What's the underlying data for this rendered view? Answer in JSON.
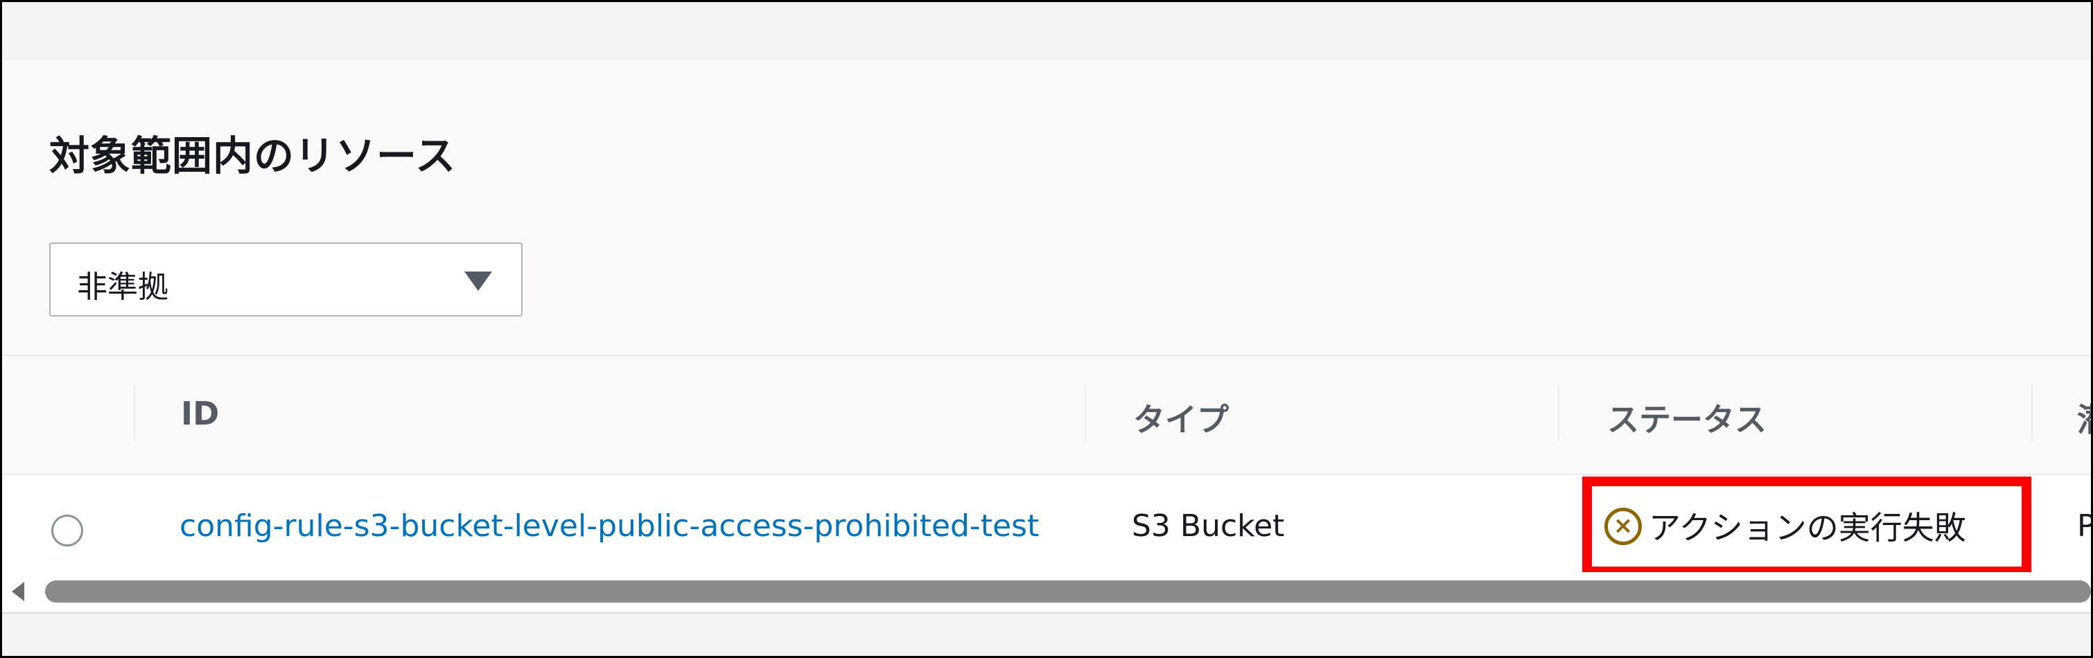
{
  "section": {
    "title": "対象範囲内のリソース"
  },
  "filter": {
    "selected": "非準拠"
  },
  "table": {
    "columns": {
      "id": "ID",
      "type": "タイプ",
      "status": "ステータス",
      "next_partial": "潜"
    },
    "rows": [
      {
        "id": "config-rule-s3-bucket-level-public-access-prohibited-test",
        "type": "S3 Bucket",
        "status": "アクションの実行失敗",
        "next_partial": "P"
      }
    ]
  },
  "icons": {
    "status": "error-circle-x-icon",
    "filter_caret": "caret-down-icon",
    "scroll_left": "scroll-left-arrow-icon"
  },
  "colors": {
    "link": "#0073bb",
    "status_icon": "#8d6605",
    "highlight": "#ff0000"
  }
}
